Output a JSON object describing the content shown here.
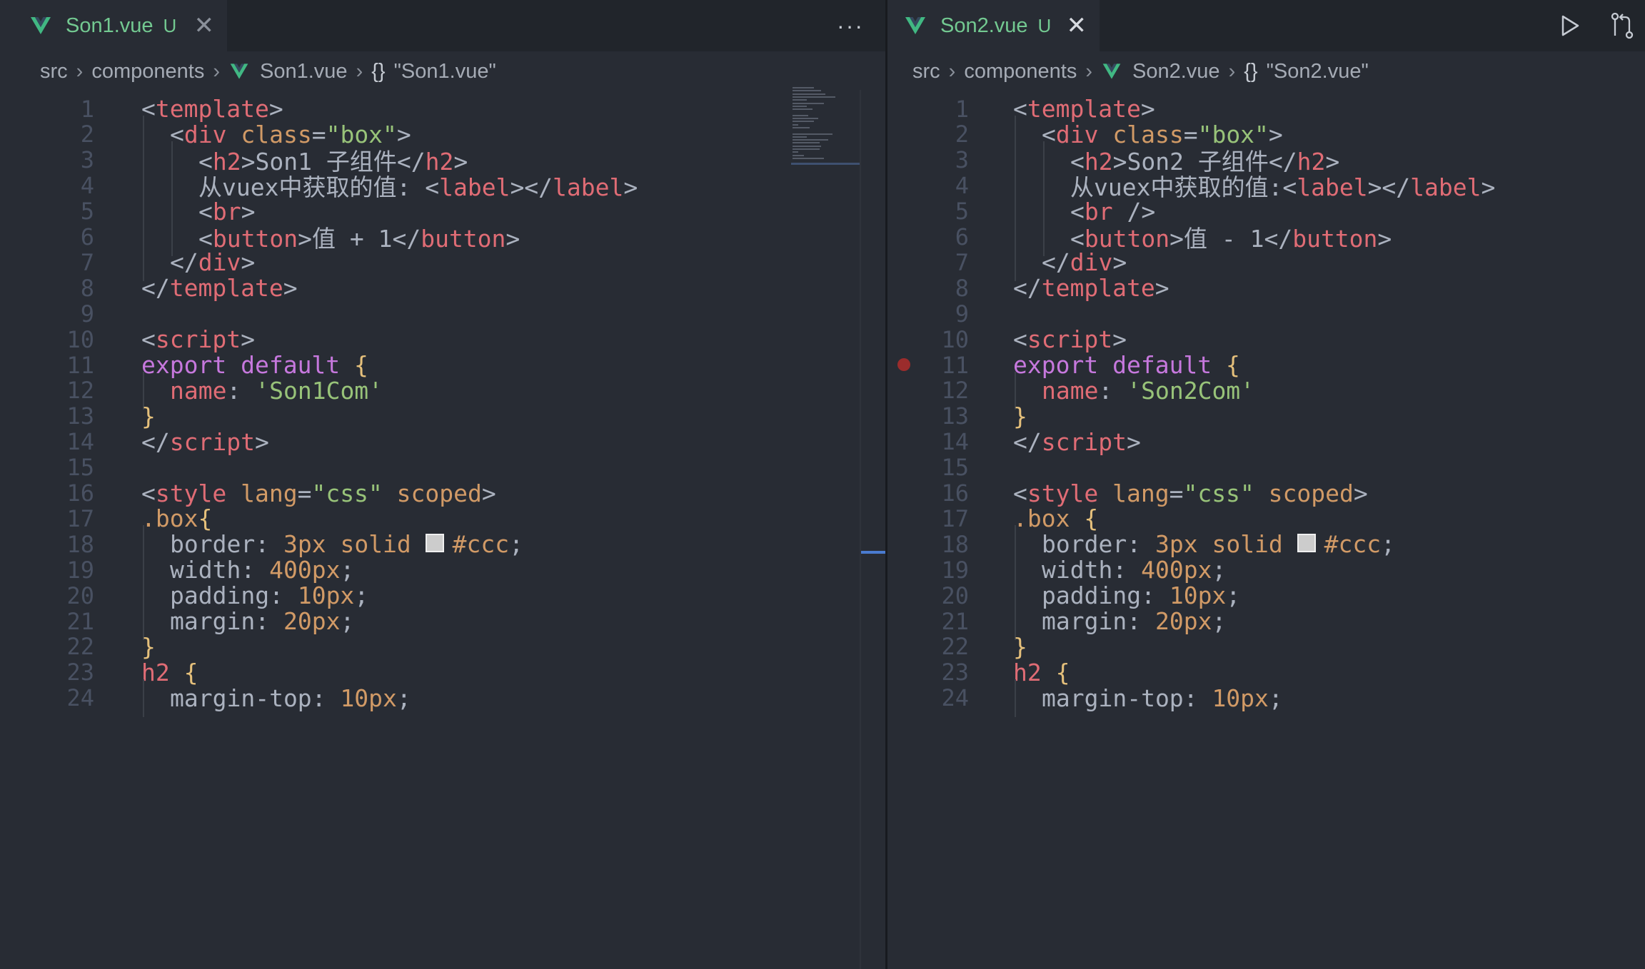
{
  "colors": {
    "background": "#282c34",
    "tab_modified": "#73c991",
    "tag": "#e06c75",
    "string": "#98c379",
    "keyword": "#c678dd",
    "brace": "#e5c07b",
    "number": "#d19a66",
    "line_number": "#495162",
    "breakpoint": "#9b2c2c"
  },
  "left": {
    "tab": {
      "name": "Son1.vue",
      "status": "U",
      "icon": "vue-icon",
      "close": "✕"
    },
    "more": "···",
    "breadcrumb": {
      "folder1": "src",
      "folder2": "components",
      "file": "Son1.vue",
      "symbol": "\"Son1.vue\""
    },
    "lines": [
      {
        "n": "1",
        "indent": 0,
        "tokens": [
          [
            "punc",
            "<"
          ],
          [
            "tag",
            "template"
          ],
          [
            "punc",
            ">"
          ]
        ]
      },
      {
        "n": "2",
        "indent": 1,
        "tokens": [
          [
            "punc",
            "<"
          ],
          [
            "tag",
            "div"
          ],
          [
            "punc",
            " "
          ],
          [
            "attr",
            "class"
          ],
          [
            "punc",
            "="
          ],
          [
            "str",
            "\"box\""
          ],
          [
            "punc",
            ">"
          ]
        ]
      },
      {
        "n": "3",
        "indent": 2,
        "tokens": [
          [
            "punc",
            "<"
          ],
          [
            "tag",
            "h2"
          ],
          [
            "punc",
            ">"
          ],
          [
            "text",
            "Son1 子组件"
          ],
          [
            "punc",
            "</"
          ],
          [
            "tag",
            "h2"
          ],
          [
            "punc",
            ">"
          ]
        ]
      },
      {
        "n": "4",
        "indent": 2,
        "tokens": [
          [
            "text",
            "从vuex中获取的值: "
          ],
          [
            "punc",
            "<"
          ],
          [
            "tag",
            "label"
          ],
          [
            "punc",
            "></"
          ],
          [
            "tag",
            "label"
          ],
          [
            "punc",
            ">"
          ]
        ]
      },
      {
        "n": "5",
        "indent": 2,
        "tokens": [
          [
            "punc",
            "<"
          ],
          [
            "tag",
            "br"
          ],
          [
            "punc",
            ">"
          ]
        ]
      },
      {
        "n": "6",
        "indent": 2,
        "tokens": [
          [
            "punc",
            "<"
          ],
          [
            "tag",
            "button"
          ],
          [
            "punc",
            ">"
          ],
          [
            "text",
            "值 + 1"
          ],
          [
            "punc",
            "</"
          ],
          [
            "tag",
            "button"
          ],
          [
            "punc",
            ">"
          ]
        ]
      },
      {
        "n": "7",
        "indent": 1,
        "tokens": [
          [
            "punc",
            "</"
          ],
          [
            "tag",
            "div"
          ],
          [
            "punc",
            ">"
          ]
        ]
      },
      {
        "n": "8",
        "indent": 0,
        "tokens": [
          [
            "punc",
            "</"
          ],
          [
            "tag",
            "template"
          ],
          [
            "punc",
            ">"
          ]
        ]
      },
      {
        "n": "9",
        "indent": 0,
        "tokens": []
      },
      {
        "n": "10",
        "indent": 0,
        "tokens": [
          [
            "punc",
            "<"
          ],
          [
            "tag",
            "script"
          ],
          [
            "punc",
            ">"
          ]
        ]
      },
      {
        "n": "11",
        "indent": 0,
        "tokens": [
          [
            "kw",
            "export"
          ],
          [
            "punc",
            " "
          ],
          [
            "kw",
            "default"
          ],
          [
            "punc",
            " "
          ],
          [
            "brace",
            "{"
          ]
        ]
      },
      {
        "n": "12",
        "indent": 1,
        "tokens": [
          [
            "key",
            "name"
          ],
          [
            "punc",
            ": "
          ],
          [
            "str",
            "'Son1Com'"
          ]
        ]
      },
      {
        "n": "13",
        "indent": 0,
        "tokens": [
          [
            "brace",
            "}"
          ]
        ]
      },
      {
        "n": "14",
        "indent": 0,
        "tokens": [
          [
            "punc",
            "</"
          ],
          [
            "tag",
            "script"
          ],
          [
            "punc",
            ">"
          ]
        ]
      },
      {
        "n": "15",
        "indent": 0,
        "tokens": []
      },
      {
        "n": "16",
        "indent": 0,
        "tokens": [
          [
            "punc",
            "<"
          ],
          [
            "tag",
            "style"
          ],
          [
            "punc",
            " "
          ],
          [
            "attr",
            "lang"
          ],
          [
            "punc",
            "="
          ],
          [
            "str",
            "\"css\""
          ],
          [
            "punc",
            " "
          ],
          [
            "attr",
            "scoped"
          ],
          [
            "punc",
            ">"
          ]
        ]
      },
      {
        "n": "17",
        "indent": 0,
        "tokens": [
          [
            "sel",
            ".box"
          ],
          [
            "brace",
            "{"
          ]
        ]
      },
      {
        "n": "18",
        "indent": 1,
        "tokens": [
          [
            "prop",
            "border"
          ],
          [
            "punc",
            ": "
          ],
          [
            "num",
            "3px"
          ],
          [
            "punc",
            " "
          ],
          [
            "attr",
            "solid"
          ],
          [
            "punc",
            " "
          ],
          [
            "swatch",
            ""
          ],
          [
            "attr",
            "#ccc"
          ],
          [
            "punc",
            ";"
          ]
        ]
      },
      {
        "n": "19",
        "indent": 1,
        "tokens": [
          [
            "prop",
            "width"
          ],
          [
            "punc",
            ": "
          ],
          [
            "num",
            "400px"
          ],
          [
            "punc",
            ";"
          ]
        ]
      },
      {
        "n": "20",
        "indent": 1,
        "tokens": [
          [
            "prop",
            "padding"
          ],
          [
            "punc",
            ": "
          ],
          [
            "num",
            "10px"
          ],
          [
            "punc",
            ";"
          ]
        ]
      },
      {
        "n": "21",
        "indent": 1,
        "tokens": [
          [
            "prop",
            "margin"
          ],
          [
            "punc",
            ": "
          ],
          [
            "num",
            "20px"
          ],
          [
            "punc",
            ";"
          ]
        ]
      },
      {
        "n": "22",
        "indent": 0,
        "tokens": [
          [
            "brace",
            "}"
          ]
        ]
      },
      {
        "n": "23",
        "indent": 0,
        "tokens": [
          [
            "tag",
            "h2"
          ],
          [
            "punc",
            " "
          ],
          [
            "brace",
            "{"
          ]
        ]
      },
      {
        "n": "24",
        "indent": 1,
        "tokens": [
          [
            "prop",
            "margin-top"
          ],
          [
            "punc",
            ": "
          ],
          [
            "num",
            "10px"
          ],
          [
            "punc",
            ";"
          ]
        ]
      }
    ]
  },
  "right": {
    "tab": {
      "name": "Son2.vue",
      "status": "U",
      "icon": "vue-icon",
      "close": "✕"
    },
    "breadcrumb": {
      "folder1": "src",
      "folder2": "components",
      "file": "Son2.vue",
      "symbol": "\"Son2.vue\""
    },
    "breakpoint_line": "11",
    "lines": [
      {
        "n": "1",
        "indent": 0,
        "tokens": [
          [
            "punc",
            "<"
          ],
          [
            "tag",
            "template"
          ],
          [
            "punc",
            ">"
          ]
        ]
      },
      {
        "n": "2",
        "indent": 1,
        "tokens": [
          [
            "punc",
            "<"
          ],
          [
            "tag",
            "div"
          ],
          [
            "punc",
            " "
          ],
          [
            "attr",
            "class"
          ],
          [
            "punc",
            "="
          ],
          [
            "str",
            "\"box\""
          ],
          [
            "punc",
            ">"
          ]
        ]
      },
      {
        "n": "3",
        "indent": 2,
        "tokens": [
          [
            "punc",
            "<"
          ],
          [
            "tag",
            "h2"
          ],
          [
            "punc",
            ">"
          ],
          [
            "text",
            "Son2 子组件"
          ],
          [
            "punc",
            "</"
          ],
          [
            "tag",
            "h2"
          ],
          [
            "punc",
            ">"
          ]
        ]
      },
      {
        "n": "4",
        "indent": 2,
        "tokens": [
          [
            "text",
            "从vuex中获取的值:"
          ],
          [
            "punc",
            "<"
          ],
          [
            "tag",
            "label"
          ],
          [
            "punc",
            "></"
          ],
          [
            "tag",
            "label"
          ],
          [
            "punc",
            ">"
          ]
        ]
      },
      {
        "n": "5",
        "indent": 2,
        "tokens": [
          [
            "punc",
            "<"
          ],
          [
            "tag",
            "br"
          ],
          [
            "punc",
            " />"
          ]
        ]
      },
      {
        "n": "6",
        "indent": 2,
        "tokens": [
          [
            "punc",
            "<"
          ],
          [
            "tag",
            "button"
          ],
          [
            "punc",
            ">"
          ],
          [
            "text",
            "值 - 1"
          ],
          [
            "punc",
            "</"
          ],
          [
            "tag",
            "button"
          ],
          [
            "punc",
            ">"
          ]
        ]
      },
      {
        "n": "7",
        "indent": 1,
        "tokens": [
          [
            "punc",
            "</"
          ],
          [
            "tag",
            "div"
          ],
          [
            "punc",
            ">"
          ]
        ]
      },
      {
        "n": "8",
        "indent": 0,
        "tokens": [
          [
            "punc",
            "</"
          ],
          [
            "tag",
            "template"
          ],
          [
            "punc",
            ">"
          ]
        ]
      },
      {
        "n": "9",
        "indent": 0,
        "tokens": []
      },
      {
        "n": "10",
        "indent": 0,
        "tokens": [
          [
            "punc",
            "<"
          ],
          [
            "tag",
            "script"
          ],
          [
            "punc",
            ">"
          ]
        ]
      },
      {
        "n": "11",
        "indent": 0,
        "tokens": [
          [
            "kw",
            "export"
          ],
          [
            "punc",
            " "
          ],
          [
            "kw",
            "default"
          ],
          [
            "punc",
            " "
          ],
          [
            "brace",
            "{"
          ]
        ]
      },
      {
        "n": "12",
        "indent": 1,
        "tokens": [
          [
            "key",
            "name"
          ],
          [
            "punc",
            ": "
          ],
          [
            "str",
            "'Son2Com'"
          ]
        ]
      },
      {
        "n": "13",
        "indent": 0,
        "tokens": [
          [
            "brace",
            "}"
          ]
        ]
      },
      {
        "n": "14",
        "indent": 0,
        "tokens": [
          [
            "punc",
            "</"
          ],
          [
            "tag",
            "script"
          ],
          [
            "punc",
            ">"
          ]
        ]
      },
      {
        "n": "15",
        "indent": 0,
        "tokens": []
      },
      {
        "n": "16",
        "indent": 0,
        "tokens": [
          [
            "punc",
            "<"
          ],
          [
            "tag",
            "style"
          ],
          [
            "punc",
            " "
          ],
          [
            "attr",
            "lang"
          ],
          [
            "punc",
            "="
          ],
          [
            "str",
            "\"css\""
          ],
          [
            "punc",
            " "
          ],
          [
            "attr",
            "scoped"
          ],
          [
            "punc",
            ">"
          ]
        ]
      },
      {
        "n": "17",
        "indent": 0,
        "tokens": [
          [
            "sel",
            ".box"
          ],
          [
            "punc",
            " "
          ],
          [
            "brace",
            "{"
          ]
        ]
      },
      {
        "n": "18",
        "indent": 1,
        "tokens": [
          [
            "prop",
            "border"
          ],
          [
            "punc",
            ": "
          ],
          [
            "num",
            "3px"
          ],
          [
            "punc",
            " "
          ],
          [
            "attr",
            "solid"
          ],
          [
            "punc",
            " "
          ],
          [
            "swatch",
            ""
          ],
          [
            "attr",
            "#ccc"
          ],
          [
            "punc",
            ";"
          ]
        ]
      },
      {
        "n": "19",
        "indent": 1,
        "tokens": [
          [
            "prop",
            "width"
          ],
          [
            "punc",
            ": "
          ],
          [
            "num",
            "400px"
          ],
          [
            "punc",
            ";"
          ]
        ]
      },
      {
        "n": "20",
        "indent": 1,
        "tokens": [
          [
            "prop",
            "padding"
          ],
          [
            "punc",
            ": "
          ],
          [
            "num",
            "10px"
          ],
          [
            "punc",
            ";"
          ]
        ]
      },
      {
        "n": "21",
        "indent": 1,
        "tokens": [
          [
            "prop",
            "margin"
          ],
          [
            "punc",
            ": "
          ],
          [
            "num",
            "20px"
          ],
          [
            "punc",
            ";"
          ]
        ]
      },
      {
        "n": "22",
        "indent": 0,
        "tokens": [
          [
            "brace",
            "}"
          ]
        ]
      },
      {
        "n": "23",
        "indent": 0,
        "tokens": [
          [
            "tag",
            "h2"
          ],
          [
            "punc",
            " "
          ],
          [
            "brace",
            "{"
          ]
        ]
      },
      {
        "n": "24",
        "indent": 1,
        "tokens": [
          [
            "prop",
            "margin-top"
          ],
          [
            "punc",
            ": "
          ],
          [
            "num",
            "10px"
          ],
          [
            "punc",
            ";"
          ]
        ]
      }
    ]
  }
}
